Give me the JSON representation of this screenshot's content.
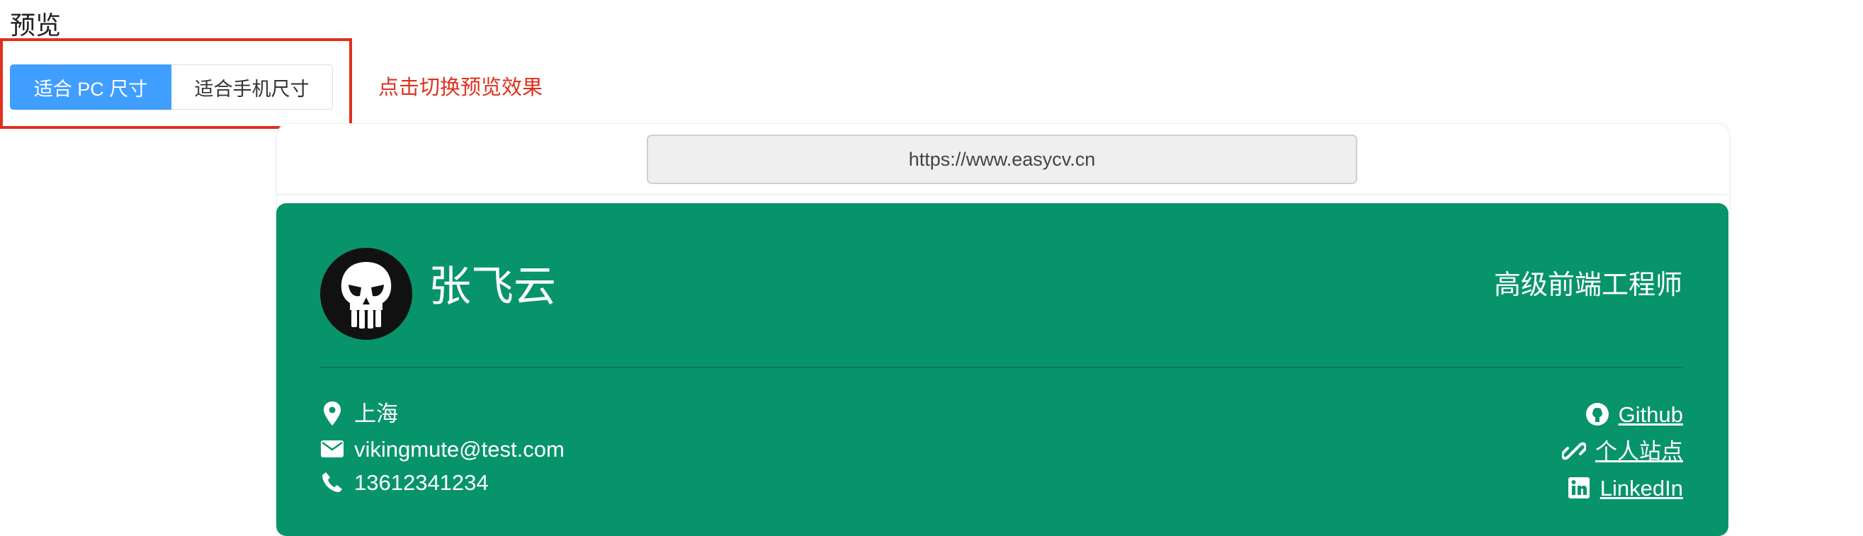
{
  "page": {
    "section_title": "预览",
    "size_toggle": {
      "pc_label": "适合 PC 尺寸",
      "mobile_label": "适合手机尺寸",
      "selected": "pc"
    },
    "hint": "点击切换预览效果"
  },
  "browser": {
    "url": "https://www.easycv.cn"
  },
  "resume": {
    "name": "张飞云",
    "job_title": "高级前端工程师",
    "accent_color": "#08946a",
    "contacts": [
      {
        "icon": "location-pin-icon",
        "text": "上海"
      },
      {
        "icon": "envelope-icon",
        "text": "vikingmute@test.com"
      },
      {
        "icon": "phone-icon",
        "text": "13612341234"
      }
    ],
    "links": [
      {
        "icon": "github-icon",
        "text": "Github"
      },
      {
        "icon": "link-icon",
        "text": "个人站点"
      },
      {
        "icon": "linkedin-icon",
        "text": "LinkedIn"
      }
    ]
  }
}
